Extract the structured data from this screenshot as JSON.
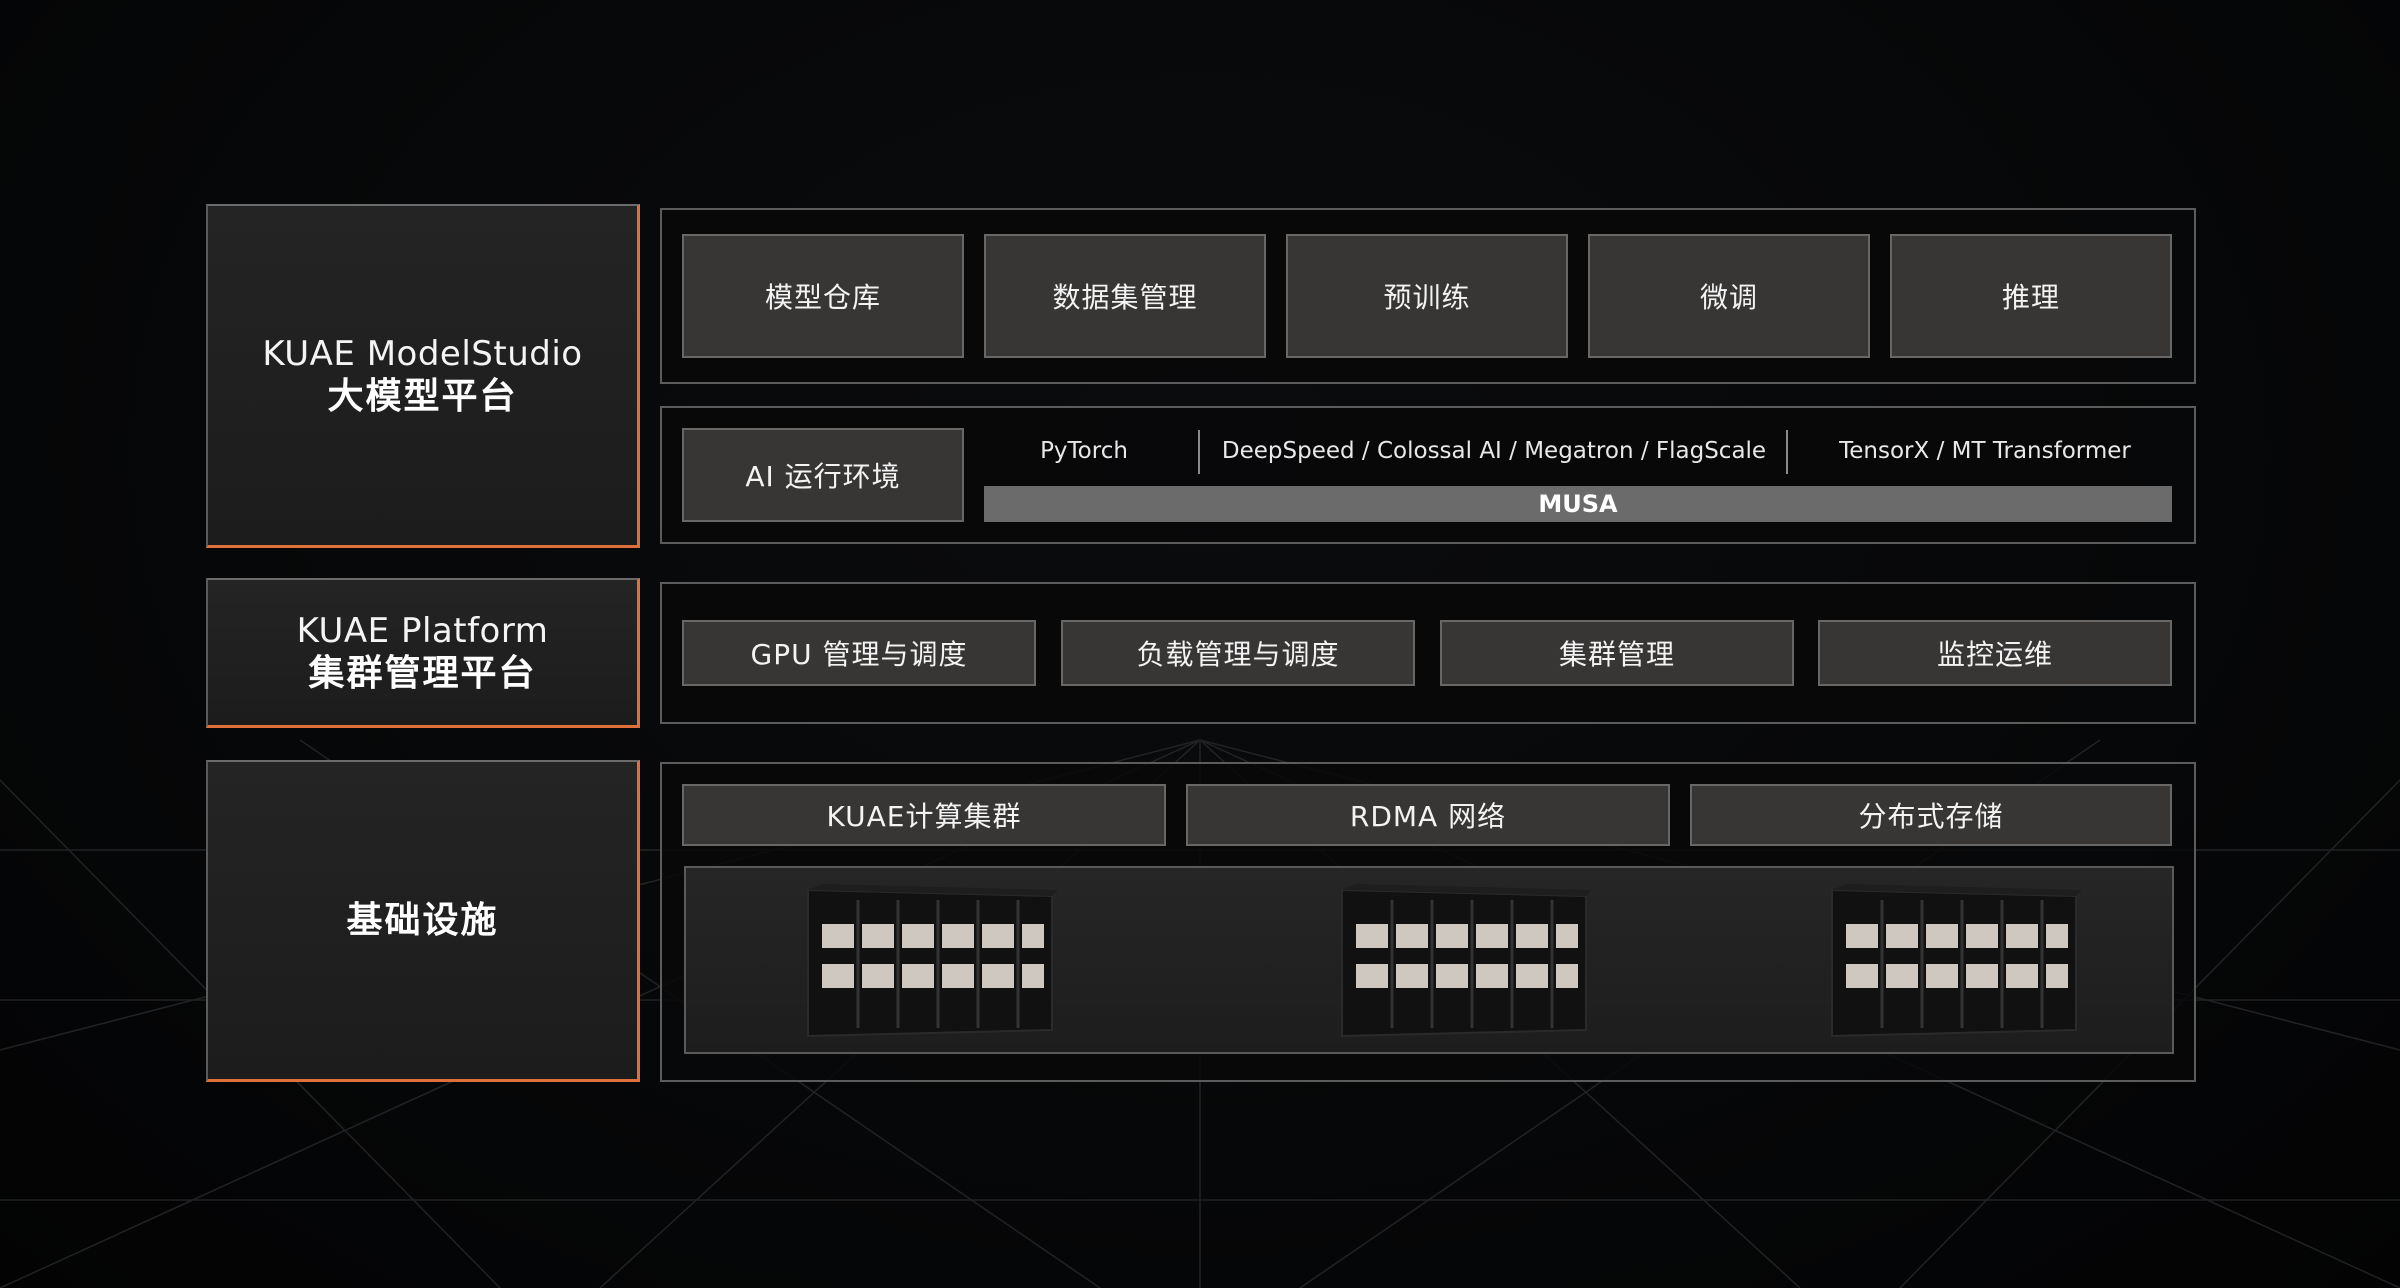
{
  "layers": {
    "model_studio": {
      "title_en": "KUAE ModelStudio",
      "title_zh": "大模型平台",
      "modules": [
        "模型仓库",
        "数据集管理",
        "预训练",
        "微调",
        "推理"
      ],
      "runtime": {
        "label": "AI 运行环境",
        "frameworks": [
          "PyTorch",
          "DeepSpeed / Colossal AI / Megatron / FlagScale",
          "TensorX / MT Transformer"
        ],
        "base": "MUSA"
      }
    },
    "platform": {
      "title_en": "KUAE Platform",
      "title_zh": "集群管理平台",
      "modules": [
        "GPU 管理与调度",
        "负载管理与调度",
        "集群管理",
        "监控运维"
      ]
    },
    "infrastructure": {
      "title_zh": "基础设施",
      "modules": [
        "KUAE计算集群",
        "RDMA 网络",
        "分布式存储"
      ]
    }
  },
  "colors": {
    "accent": "#e0703a",
    "tile": "#373635",
    "musa_bar": "#6b6b6c"
  }
}
